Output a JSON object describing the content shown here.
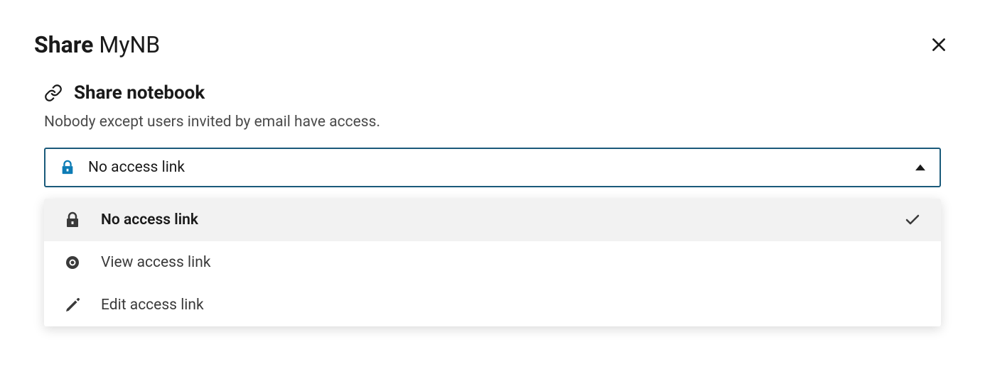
{
  "header": {
    "title_prefix": "Share",
    "title_suffix": "MyNB"
  },
  "section": {
    "title": "Share notebook",
    "description": "Nobody except users invited by email have access."
  },
  "select": {
    "current": "No access link"
  },
  "options": [
    {
      "label": "No access link",
      "selected": true
    },
    {
      "label": "View access link",
      "selected": false
    },
    {
      "label": "Edit access link",
      "selected": false
    }
  ]
}
